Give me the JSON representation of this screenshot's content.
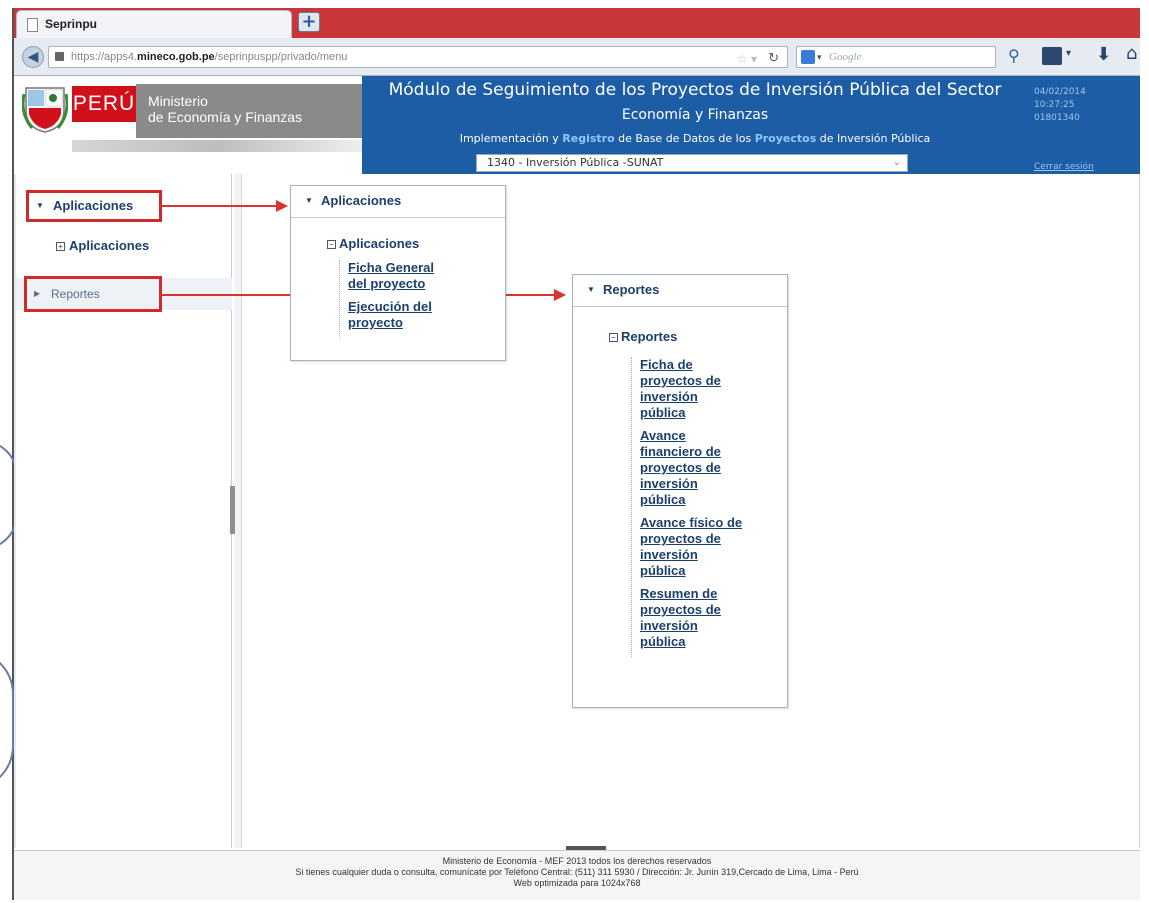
{
  "browser": {
    "tab_title": "Seprinpu",
    "new_tab": "+",
    "url_prefix": "https://apps4.",
    "url_domain": "mineco.gob.pe",
    "url_path": "/seprinpuspp/privado/menu",
    "search_placeholder": "Google"
  },
  "header": {
    "country": "PERÚ",
    "ministry_line1": "Ministerio",
    "ministry_line2": "de Economía y Finanzas",
    "title": "Módulo de Seguimiento de los Proyectos de Inversión Pública del Sector",
    "subtitle": "Economía y Finanzas",
    "impl_1": "Implementación y ",
    "impl_hl1": "Registro",
    "impl_2": " de Base de Datos de los ",
    "impl_hl2": "Proyectos",
    "impl_3": " de Inversión Pública",
    "selected_unit": "1340 - Inversión Pública -SUNAT",
    "date": "04/02/2014",
    "time": "10:27:25",
    "user": "01801340",
    "logout": "Cerrar sesión"
  },
  "sidebar": {
    "apps_header": "Aplicaciones",
    "apps_item": "Aplicaciones",
    "reports_header": "Reportes"
  },
  "apps_panel": {
    "header": "Aplicaciones",
    "group": "Aplicaciones",
    "links": [
      "Ficha General del proyecto",
      "Ejecución del proyecto"
    ]
  },
  "reports_panel": {
    "header": "Reportes",
    "group": "Reportes",
    "links": [
      "Ficha de proyectos de inversión pública",
      "Avance financiero de proyectos de inversión pública",
      "Avance físico de proyectos de inversión pública",
      "Resumen de proyectos de inversión pública"
    ]
  },
  "footer": {
    "line1": "Ministerio de Economía - MEF 2013 todos los derechos reservados",
    "line2": "Si tienes cualquier duda o consulta, comunícate por Teléfono Central: (511) 311 5930 / Dirección: Jr. Junín 319,Cercado de Lima, Lima - Perú",
    "line3": "Web optimizada para 1024x768"
  },
  "colors": {
    "header_blue": "#1d5da6",
    "tabbar_red": "#c9363a",
    "highlight_red": "#d02b2b",
    "link_navy": "#1d3f6d"
  }
}
